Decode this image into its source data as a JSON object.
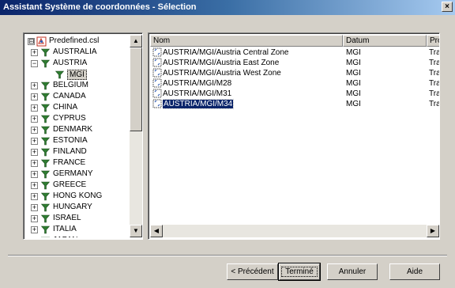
{
  "window": {
    "title": "Assistant Système de coordonnées - Sélection",
    "close_glyph": "×"
  },
  "tree": {
    "root": {
      "label": "Predefined.csl",
      "expander": "⊟"
    },
    "items": [
      {
        "label": "AUSTRALIA",
        "expander": "+"
      },
      {
        "label": "AUSTRIA",
        "expander": "−"
      },
      {
        "label": "MGI",
        "expander": ""
      },
      {
        "label": "BELGIUM",
        "expander": "+"
      },
      {
        "label": "CANADA",
        "expander": "+"
      },
      {
        "label": "CHINA",
        "expander": "+"
      },
      {
        "label": "CYPRUS",
        "expander": "+"
      },
      {
        "label": "DENMARK",
        "expander": "+"
      },
      {
        "label": "ESTONIA",
        "expander": "+"
      },
      {
        "label": "FINLAND",
        "expander": "+"
      },
      {
        "label": "FRANCE",
        "expander": "+"
      },
      {
        "label": "GERMANY",
        "expander": "+"
      },
      {
        "label": "GREECE",
        "expander": "+"
      },
      {
        "label": "HONG KONG",
        "expander": "+"
      },
      {
        "label": "HUNGARY",
        "expander": "+"
      },
      {
        "label": "ISRAEL",
        "expander": "+"
      },
      {
        "label": "ITALIA",
        "expander": "+"
      },
      {
        "label": "JAPAN",
        "expander": "+"
      }
    ]
  },
  "list": {
    "columns": [
      "Nom",
      "Datum",
      "Pro"
    ],
    "rows": [
      {
        "name": "AUSTRIA/MGI/Austria Central Zone",
        "datum": "MGI",
        "proj": "Tra"
      },
      {
        "name": "AUSTRIA/MGI/Austria East Zone",
        "datum": "MGI",
        "proj": "Tra"
      },
      {
        "name": "AUSTRIA/MGI/Austria West Zone",
        "datum": "MGI",
        "proj": "Tra"
      },
      {
        "name": "AUSTRIA/MGI/M28",
        "datum": "MGI",
        "proj": "Tra"
      },
      {
        "name": "AUSTRIA/MGI/M31",
        "datum": "MGI",
        "proj": "Tra"
      },
      {
        "name": "AUSTRIA/MGI/M34",
        "datum": "MGI",
        "proj": "Tra"
      }
    ],
    "selected_index": 5
  },
  "scroll_arrows": {
    "up": "▲",
    "down": "▼",
    "left": "◀",
    "right": "▶"
  },
  "buttons": {
    "previous": "< Précédent",
    "finish": "Terminé",
    "cancel": "Annuler",
    "help": "Aide"
  },
  "colors": {
    "title_start": "#0a246a",
    "selection": "#0a246a",
    "funnel_green": "#2f7d32"
  }
}
